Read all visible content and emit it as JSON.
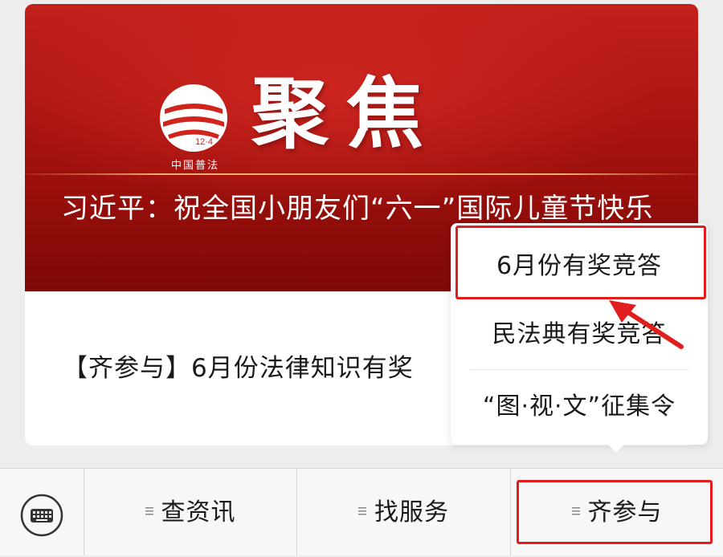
{
  "card": {
    "logo_caption": "中国普法",
    "logo_number": "12·4",
    "logo_char": "法",
    "banner_big": "聚焦",
    "banner_title": "习近平：祝全国小朋友们“六一”国际儿童节快乐",
    "article_text": "【齐参与】6月份法律知识有奖"
  },
  "popup_menu": {
    "items": [
      {
        "label": "6月份有奖竞答"
      },
      {
        "label": "民法典有奖竞答"
      },
      {
        "label": "“图·视·文”征集令"
      }
    ]
  },
  "bottom_nav": {
    "tabs": [
      {
        "label": "查资讯",
        "icon": "menu-lines-icon"
      },
      {
        "label": "找服务",
        "icon": "menu-lines-icon"
      },
      {
        "label": "齐参与",
        "icon": "menu-lines-icon"
      }
    ],
    "keyboard_icon": "keyboard-icon"
  },
  "colors": {
    "banner_red": "#b5150f",
    "highlight_red": "#e11d1d"
  }
}
